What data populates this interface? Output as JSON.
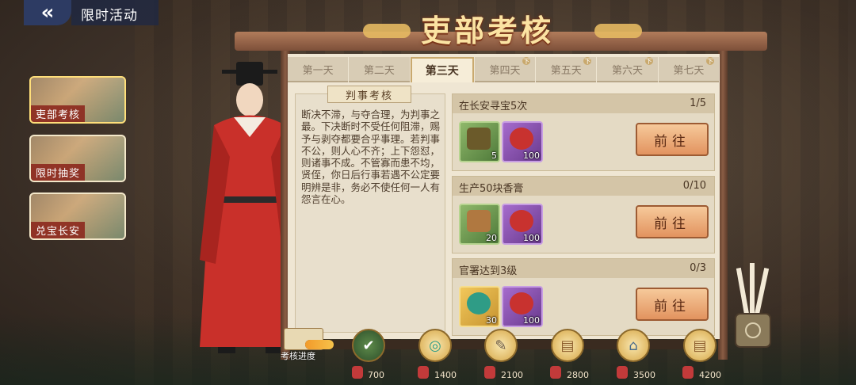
{
  "header": {
    "back_icon": "double-chevron-left-icon",
    "title": "限时活动"
  },
  "sidebar": {
    "items": [
      {
        "label": "吏部考核",
        "active": true
      },
      {
        "label": "限时抽奖",
        "active": false
      },
      {
        "label": "兑宝长安",
        "active": false
      }
    ]
  },
  "main": {
    "title": "吏部考核",
    "tabs": [
      {
        "label": "第一天",
        "active": false,
        "locked": false
      },
      {
        "label": "第二天",
        "active": false,
        "locked": false
      },
      {
        "label": "第三天",
        "active": true,
        "locked": false
      },
      {
        "label": "第四天",
        "active": false,
        "locked": true
      },
      {
        "label": "第五天",
        "active": false,
        "locked": true
      },
      {
        "label": "第六天",
        "active": false,
        "locked": true
      },
      {
        "label": "第七天",
        "active": false,
        "locked": true
      }
    ],
    "lock_glyph": "下",
    "description": {
      "title": "判事考核",
      "text": "断决不滞，与夺合理，为判事之最。下决断时不受任何阻滞，赐予与剥夺都要合乎事理。若判事不公，则人心不齐；上下怨怼，则诸事不成。不管寡而患不均，贤侄，你日后行事若遇不公定要明辨是非，务必不使任何一人有怨言在心。"
    },
    "tasks": [
      {
        "title": "在长安寻宝5次",
        "progress": "1/5",
        "rewards": [
          {
            "icon": "chest-icon",
            "count": "5",
            "color": "green"
          },
          {
            "icon": "red-pouch-icon",
            "count": "100",
            "color": "purple"
          }
        ],
        "button": "前往"
      },
      {
        "title": "生产50块香膏",
        "progress": "0/10",
        "rewards": [
          {
            "icon": "ingot-icon",
            "count": "20",
            "color": "green"
          },
          {
            "icon": "red-pouch-icon",
            "count": "100",
            "color": "purple"
          }
        ],
        "button": "前往"
      },
      {
        "title": "官署达到3级",
        "progress": "0/3",
        "rewards": [
          {
            "icon": "jade-icon",
            "count": "30",
            "color": "green"
          },
          {
            "icon": "red-pouch-icon",
            "count": "100",
            "color": "purple"
          }
        ],
        "button": "前往"
      }
    ]
  },
  "progress": {
    "label": "考核进度",
    "fill_fraction": 0.07,
    "milestones": [
      {
        "value": "700",
        "icon": "check-icon",
        "done": true
      },
      {
        "value": "1400",
        "icon": "jade-icon",
        "done": false
      },
      {
        "value": "2100",
        "icon": "brush-icon",
        "done": false
      },
      {
        "value": "2800",
        "icon": "scroll-icon",
        "done": false
      },
      {
        "value": "3500",
        "icon": "building-icon",
        "done": false
      },
      {
        "value": "4200",
        "icon": "scroll-icon",
        "done": false
      }
    ]
  },
  "colors": {
    "accent": "#c9a96e",
    "button": "#e2935f",
    "title": "#fbe3a2"
  }
}
